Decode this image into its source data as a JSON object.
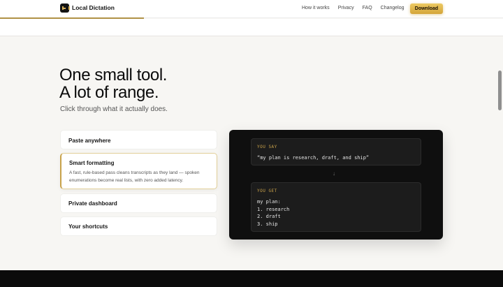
{
  "nav": {
    "brand": "Local Dictation",
    "links": [
      "How it works",
      "Privacy",
      "FAQ",
      "Changelog"
    ],
    "download_label": "Download"
  },
  "hero": {
    "title_line1": "One small tool.",
    "title_line2": "A lot of range.",
    "subtitle": "Click through what it actually does."
  },
  "features": [
    {
      "title": "Paste anywhere"
    },
    {
      "title": "Smart formatting",
      "description": "A fast, rule-based pass cleans transcripts as they land — spoken enumerations become real lists, with zero added latency."
    },
    {
      "title": "Private dashboard"
    },
    {
      "title": "Your shortcuts"
    }
  ],
  "demo": {
    "say_label": "YOU SAY",
    "say_text": "“my plan is research, draft, and ship”",
    "arrow": "↓",
    "get_label": "YOU GET",
    "get_text": "my plan:\n1. research\n2. draft\n3. ship"
  },
  "colors": {
    "accent": "#c8a24a",
    "download_button": "#e0b64d",
    "demo_background": "#0f0f0f"
  }
}
